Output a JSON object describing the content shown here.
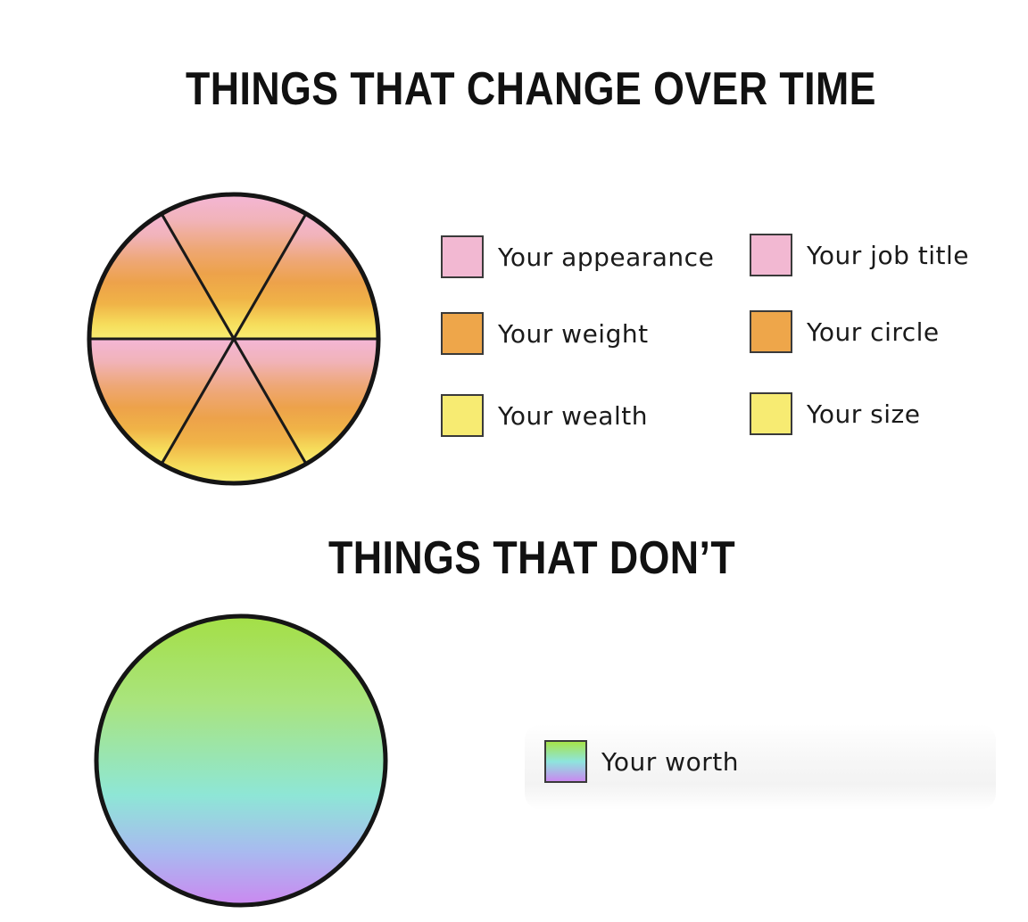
{
  "chart_data": [
    {
      "type": "pie",
      "title": "THINGS THAT CHANGE OVER TIME",
      "categories": [
        "Your appearance",
        "Your job title",
        "Your weight",
        "Your circle",
        "Your wealth",
        "Your size"
      ],
      "values": [
        1,
        1,
        1,
        1,
        1,
        1
      ],
      "colors": [
        "#f2b8d2",
        "#f2b8d2",
        "#eea64a",
        "#eea64a",
        "#f7eb72",
        "#f7eb72"
      ],
      "legend_placement": "right"
    },
    {
      "type": "pie",
      "title": "THINGS THAT DON’T",
      "categories": [
        "Your worth"
      ],
      "values": [
        1
      ],
      "colors": [
        "gradient: #a6e24a → #8ee5dd → #c98af0"
      ],
      "legend_placement": "right"
    }
  ],
  "legend1": [
    {
      "label": "Your appearance",
      "color": "#f2b8d2"
    },
    {
      "label": "Your job title",
      "color": "#f2b8d2"
    },
    {
      "label": "Your weight",
      "color": "#eea64a"
    },
    {
      "label": "Your circle",
      "color": "#eea64a"
    },
    {
      "label": "Your wealth",
      "color": "#f7eb72"
    },
    {
      "label": "Your size",
      "color": "#f7eb72"
    }
  ],
  "legend2": [
    {
      "label": "Your worth",
      "color": "gradient"
    }
  ]
}
